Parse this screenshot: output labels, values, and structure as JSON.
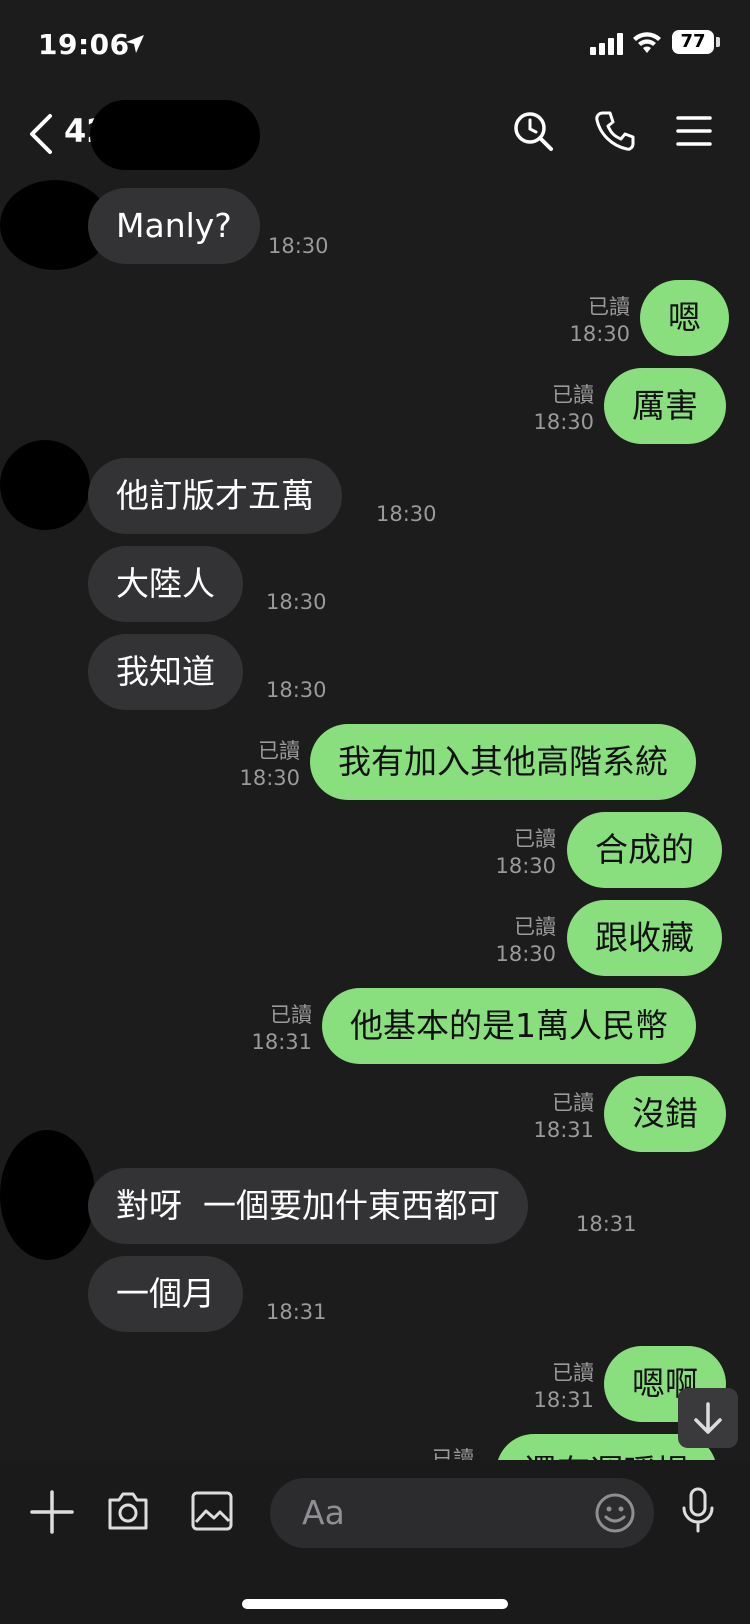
{
  "status": {
    "time": "19:06",
    "battery": "77"
  },
  "header": {
    "title": "42"
  },
  "messages": [
    {
      "dir": "in",
      "text": "Manly?",
      "time": "18:30"
    },
    {
      "dir": "out",
      "text": "嗯",
      "time": "18:30",
      "read": "已讀"
    },
    {
      "dir": "out",
      "text": "厲害",
      "time": "18:30",
      "read": "已讀"
    },
    {
      "dir": "in",
      "text": "他訂版才五萬",
      "time": "18:30"
    },
    {
      "dir": "in",
      "text": "大陸人",
      "time": "18:30"
    },
    {
      "dir": "in",
      "text": "我知道",
      "time": "18:30"
    },
    {
      "dir": "out",
      "text": "我有加入其他高階系統",
      "time": "18:30",
      "read": "已讀"
    },
    {
      "dir": "out",
      "text": "合成的",
      "time": "18:30",
      "read": "已讀"
    },
    {
      "dir": "out",
      "text": "跟收藏",
      "time": "18:30",
      "read": "已讀"
    },
    {
      "dir": "out",
      "text": "他基本的是1萬人民幣",
      "time": "18:31",
      "read": "已讀"
    },
    {
      "dir": "out",
      "text": "沒錯",
      "time": "18:31",
      "read": "已讀"
    },
    {
      "dir": "in",
      "text": "對呀  一個要加什東西都可",
      "time": "18:31"
    },
    {
      "dir": "in",
      "text": "一個月",
      "time": "18:31"
    },
    {
      "dir": "out",
      "text": "嗯啊",
      "time": "18:31",
      "read": "已讀"
    },
    {
      "dir": "out",
      "text": "還有運暖場",
      "time": "",
      "read": "已讀"
    }
  ],
  "input": {
    "placeholder": "Aa"
  },
  "colors": {
    "background": "#1c1c1c",
    "outgoing_bubble": "#89df7e",
    "incoming_bubble": "#333335"
  },
  "icons": [
    "back-chevron-icon",
    "search-icon",
    "phone-icon",
    "menu-icon",
    "plus-icon",
    "camera-icon",
    "image-icon",
    "emoji-icon",
    "microphone-icon",
    "scroll-down-icon"
  ]
}
